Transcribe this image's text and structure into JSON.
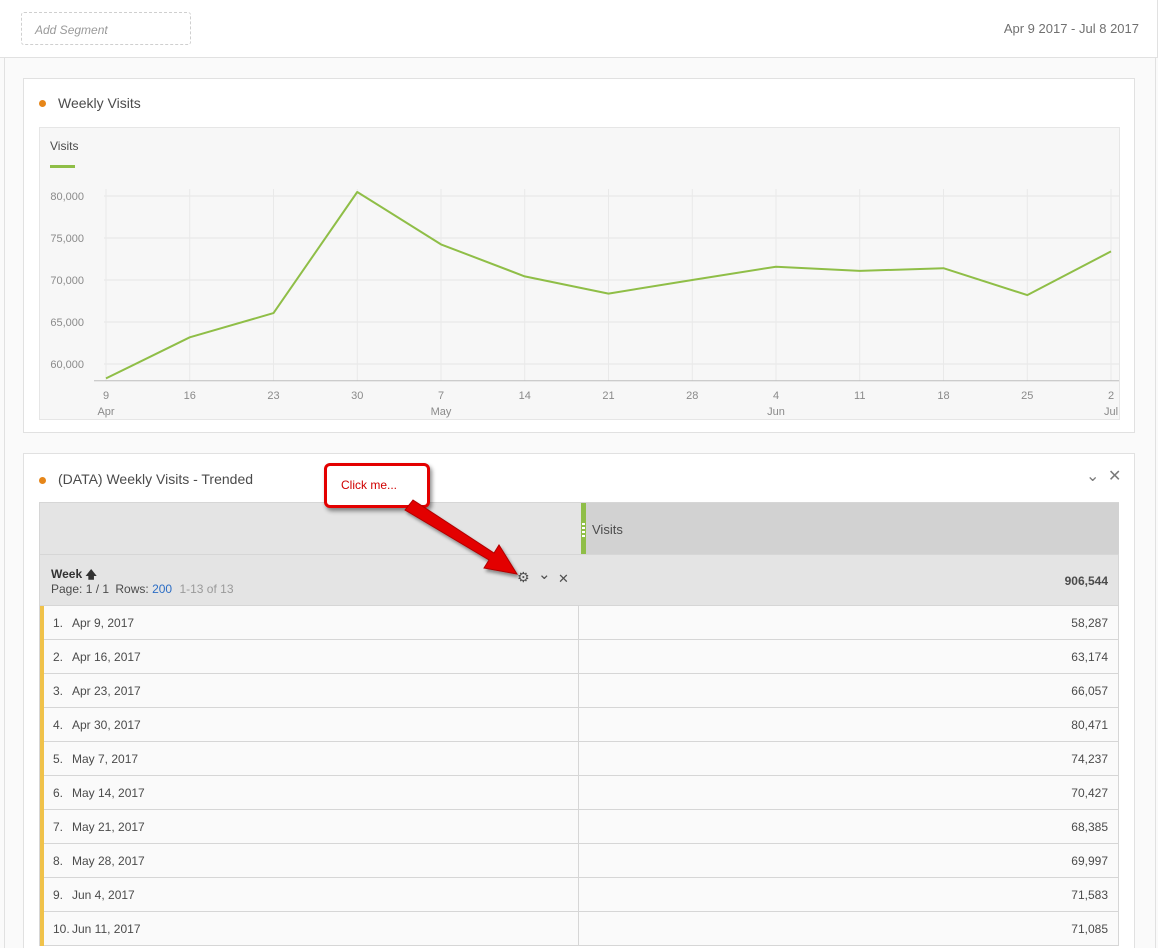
{
  "toolbar": {
    "add_segment_placeholder": "Add Segment",
    "date_range": "Apr 9 2017 - Jul 8 2017"
  },
  "panel1": {
    "title": "Weekly Visits",
    "legend": "Visits"
  },
  "chart_data": {
    "type": "line",
    "title": "Weekly Visits",
    "series": [
      {
        "name": "Visits",
        "color": "#8fbe47",
        "values": [
          58287,
          63174,
          66057,
          80471,
          74237,
          70427,
          68385,
          69997,
          71583,
          71085,
          71400,
          68200,
          73400
        ]
      }
    ],
    "x_ticks": [
      {
        "day": "9",
        "month": "Apr"
      },
      {
        "day": "16",
        "month": ""
      },
      {
        "day": "23",
        "month": ""
      },
      {
        "day": "30",
        "month": ""
      },
      {
        "day": "7",
        "month": "May"
      },
      {
        "day": "14",
        "month": ""
      },
      {
        "day": "21",
        "month": ""
      },
      {
        "day": "28",
        "month": ""
      },
      {
        "day": "4",
        "month": "Jun"
      },
      {
        "day": "11",
        "month": ""
      },
      {
        "day": "18",
        "month": ""
      },
      {
        "day": "25",
        "month": ""
      },
      {
        "day": "2",
        "month": "Jul"
      }
    ],
    "y_ticks": [
      "80,000",
      "75,000",
      "70,000",
      "65,000",
      "60,000"
    ],
    "y_tick_values": [
      80000,
      75000,
      70000,
      65000,
      60000
    ],
    "ylim": [
      58000,
      81000
    ],
    "grid": true,
    "legend_position": "top-left"
  },
  "panel2": {
    "title": "(DATA) Weekly Visits - Trended",
    "metric": "Visits",
    "dimension": "Week",
    "sort_icon": "arrow-up-icon",
    "page_label": "Page: 1 / 1",
    "rows_label": "Rows:",
    "rows_value": "200",
    "range": "1-13 of 13",
    "total": "906,544",
    "rows": [
      {
        "num": "1.",
        "week": "Apr 9, 2017",
        "visits": "58,287"
      },
      {
        "num": "2.",
        "week": "Apr 16, 2017",
        "visits": "63,174"
      },
      {
        "num": "3.",
        "week": "Apr 23, 2017",
        "visits": "66,057"
      },
      {
        "num": "4.",
        "week": "Apr 30, 2017",
        "visits": "80,471"
      },
      {
        "num": "5.",
        "week": "May 7, 2017",
        "visits": "74,237"
      },
      {
        "num": "6.",
        "week": "May 14, 2017",
        "visits": "70,427"
      },
      {
        "num": "7.",
        "week": "May 21, 2017",
        "visits": "68,385"
      },
      {
        "num": "8.",
        "week": "May 28, 2017",
        "visits": "69,997"
      },
      {
        "num": "9.",
        "week": "Jun 4, 2017",
        "visits": "71,583"
      },
      {
        "num": "10.",
        "week": "Jun 11, 2017",
        "visits": "71,085"
      }
    ]
  },
  "callout": {
    "text": "Click me..."
  },
  "colors": {
    "accent_line": "#8fbe47",
    "panel_dot": "#e68619",
    "callout_red": "#e30000",
    "row_accent": "#f0c24a",
    "link_blue": "#2d6ec5"
  }
}
